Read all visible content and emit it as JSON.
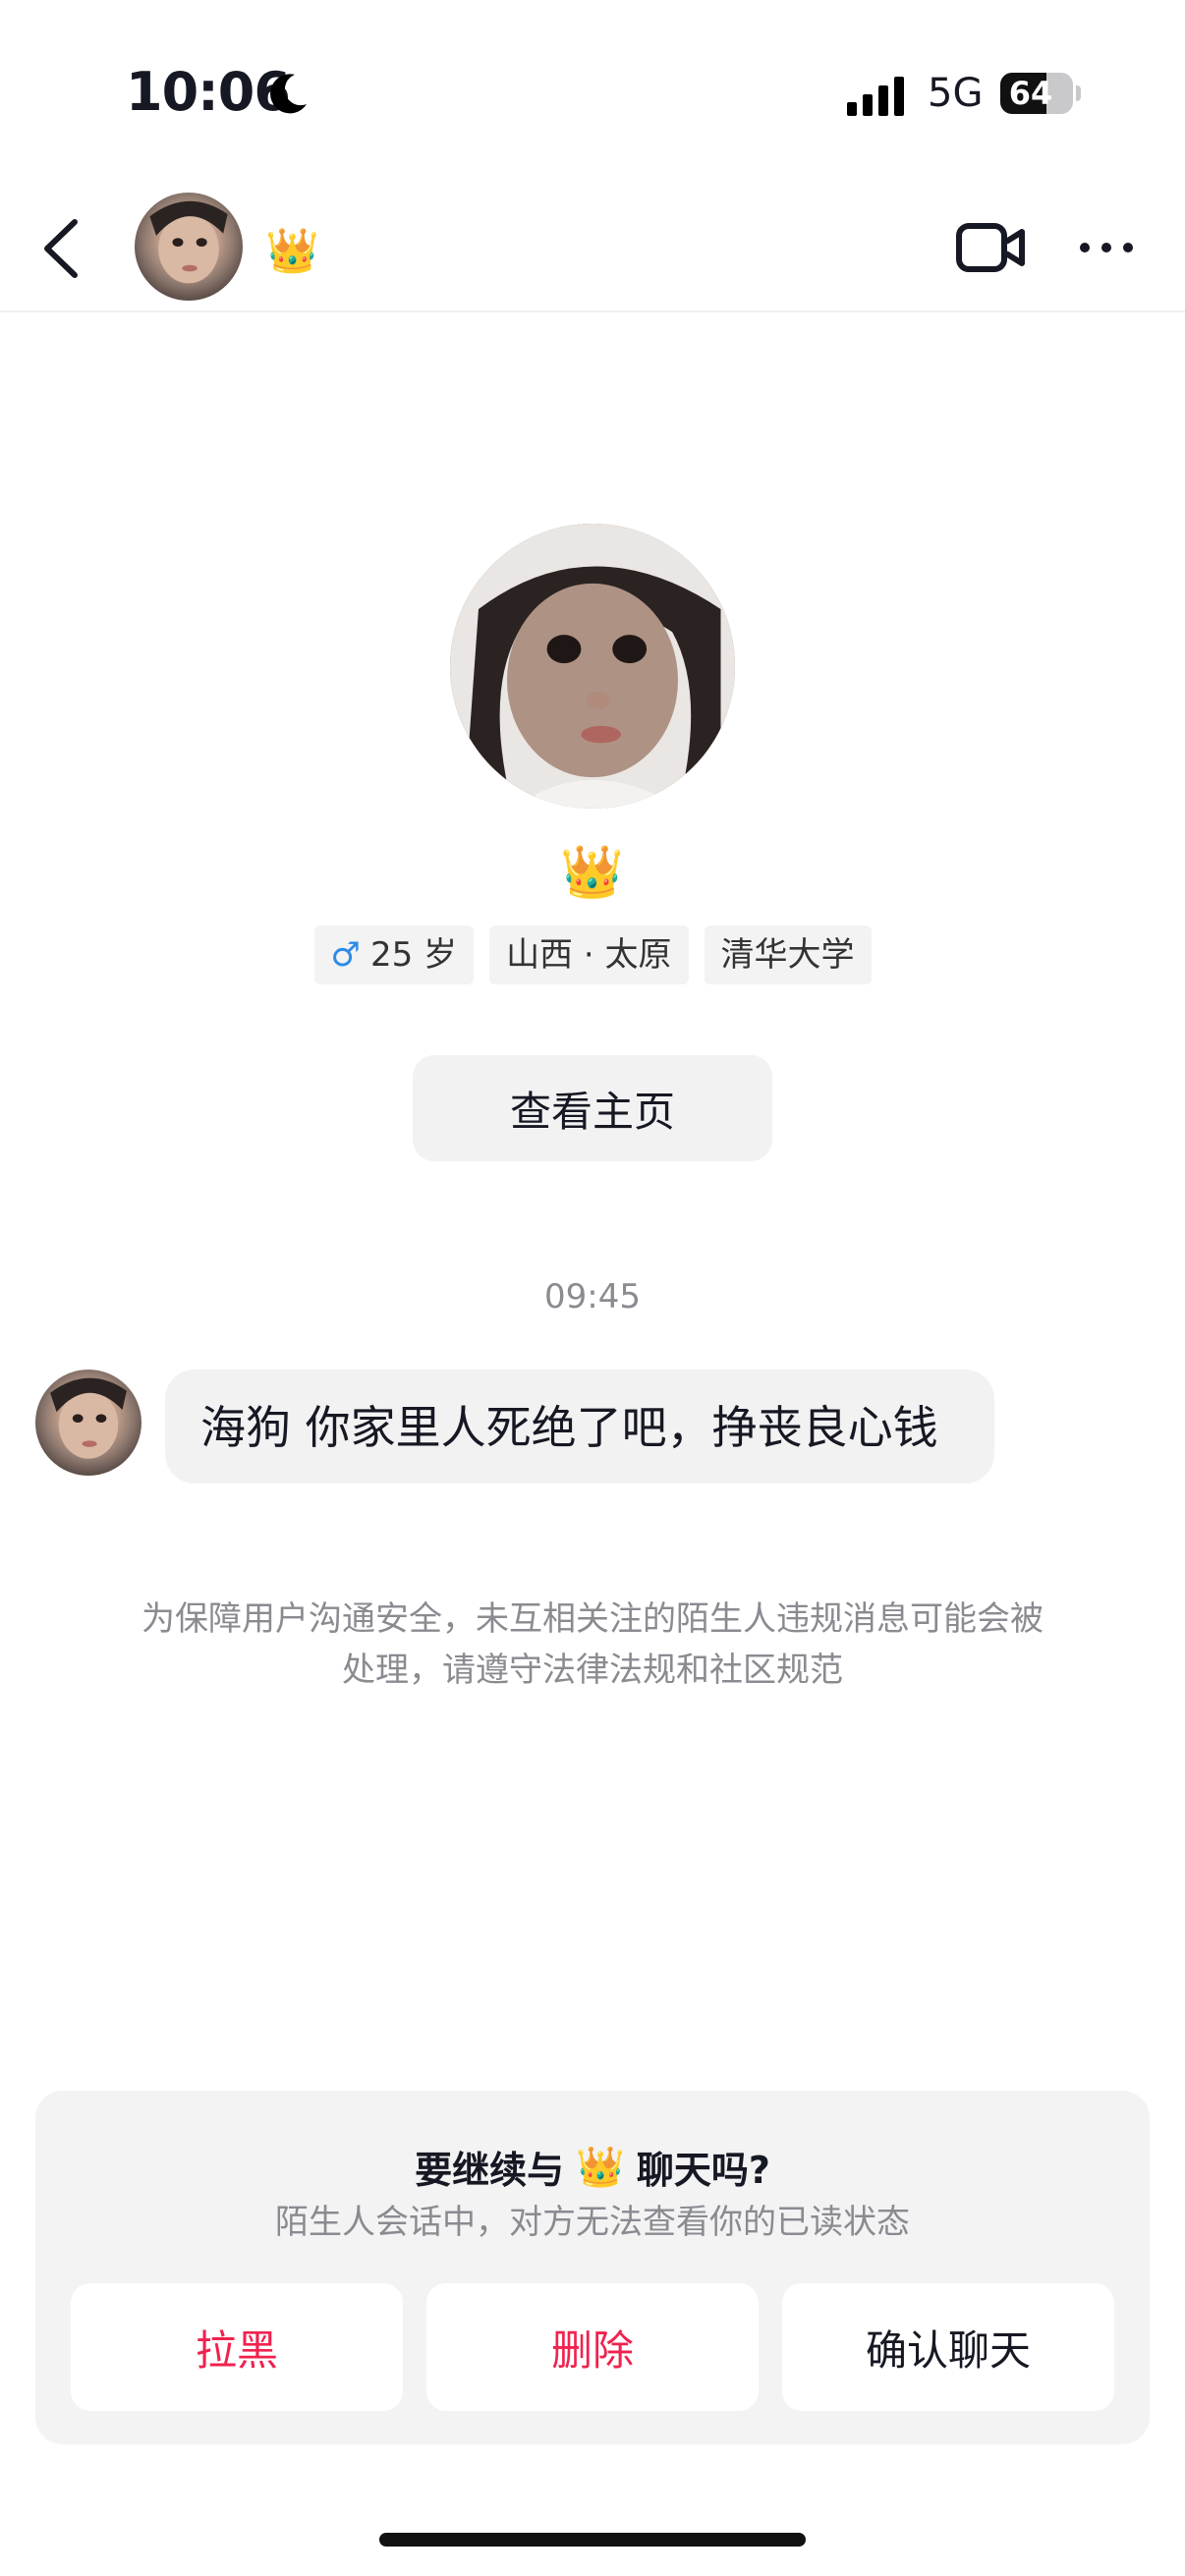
{
  "status_bar": {
    "time": "10:06",
    "network": "5G",
    "battery": "64",
    "battery_level": 0.64
  },
  "header": {
    "user_emoji": "👑"
  },
  "profile": {
    "emoji": "👑",
    "tags": [
      {
        "icon": "♂",
        "label": "25 岁"
      },
      {
        "label": "山西 · 太原"
      },
      {
        "label": "清华大学"
      }
    ],
    "view_button": "查看主页"
  },
  "chat": {
    "timestamp": "09:45",
    "messages": [
      {
        "text": "海狗 你家里人死绝了吧，挣丧良心钱"
      }
    ],
    "notice": "为保障用户沟通安全，未互相关注的陌生人违规消息可能会被处理，请遵守法律法规和社区规范"
  },
  "prompt": {
    "title_prefix": "要继续与",
    "title_emoji": "👑",
    "title_suffix": "聊天吗?",
    "subtitle": "陌生人会话中，对方无法查看你的已读状态",
    "buttons": {
      "block": "拉黑",
      "delete": "删除",
      "confirm": "确认聊天"
    }
  },
  "colors": {
    "danger": "#f0224f",
    "gender_male": "#2d8ce4",
    "muted": "#8a8b91"
  }
}
